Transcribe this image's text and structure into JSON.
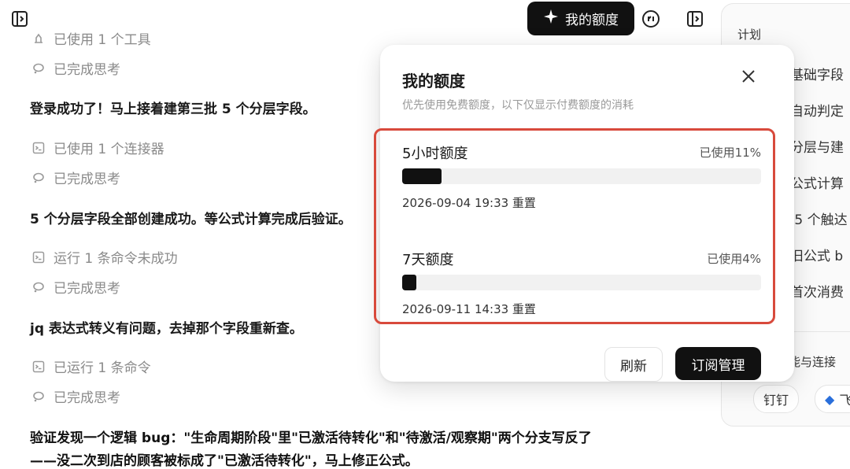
{
  "header": {
    "quota_button_label": "我的额度"
  },
  "feed": {
    "items": [
      {
        "type": "tool",
        "text": "已使用 1 个工具",
        "icon": "tool-icon"
      },
      {
        "type": "thought",
        "text": "已完成思考",
        "icon": "thought-icon"
      },
      {
        "type": "message",
        "text": "登录成功了！马上接着建第三批 5 个分层字段。"
      },
      {
        "type": "connector",
        "text": "已使用 1 个连接器",
        "icon": "terminal-icon"
      },
      {
        "type": "thought",
        "text": "已完成思考",
        "icon": "thought-icon"
      },
      {
        "type": "message",
        "text": "5 个分层字段全部创建成功。等公式计算完成后验证。"
      },
      {
        "type": "command",
        "text": "运行 1 条命令未成功",
        "icon": "terminal-icon"
      },
      {
        "type": "thought",
        "text": "已完成思考",
        "icon": "thought-icon"
      },
      {
        "type": "message",
        "text": "jq 表达式转义有问题，去掉那个字段重新查。"
      },
      {
        "type": "command",
        "text": "已运行 1 条命令",
        "icon": "terminal-icon"
      },
      {
        "type": "thought",
        "text": "已完成思考",
        "icon": "thought-icon"
      },
      {
        "type": "message_bold",
        "text": "验证发现一个逻辑 bug：\"生命周期阶段\"里\"已激活待转化\"和\"待激活/观察期\"两个分支写反了"
      },
      {
        "type": "message_bold",
        "text": "——没二次到店的顾客被标成了\"已激活待转化\"，马上修正公式。"
      }
    ]
  },
  "plan": {
    "title": "计划",
    "items": [
      "建基础字段",
      "建自动判定",
      "建分层与建",
      "证公式计算",
      "建 5 个触达",
      "复旧公式 b",
      "填首次消费"
    ],
    "skills_label": "技能与连接",
    "chips": [
      "钉钉",
      "飞"
    ]
  },
  "popover": {
    "title": "我的额度",
    "subtitle": "优先使用免费额度，以下仅显示付费额度的消耗",
    "quotas": [
      {
        "name": "5小时额度",
        "used_label": "已使用11%",
        "used_fraction": 0.11,
        "reset": "2026-09-04 19:33 重置"
      },
      {
        "name": "7天额度",
        "used_label": "已使用4%",
        "used_fraction": 0.04,
        "reset": "2026-09-11 14:33 重置"
      }
    ],
    "refresh_label": "刷新",
    "subscription_label": "订阅管理"
  },
  "colors": {
    "accent_dark": "#111111",
    "highlight_border": "#d84a3c",
    "muted_text": "#8a8a8a"
  }
}
